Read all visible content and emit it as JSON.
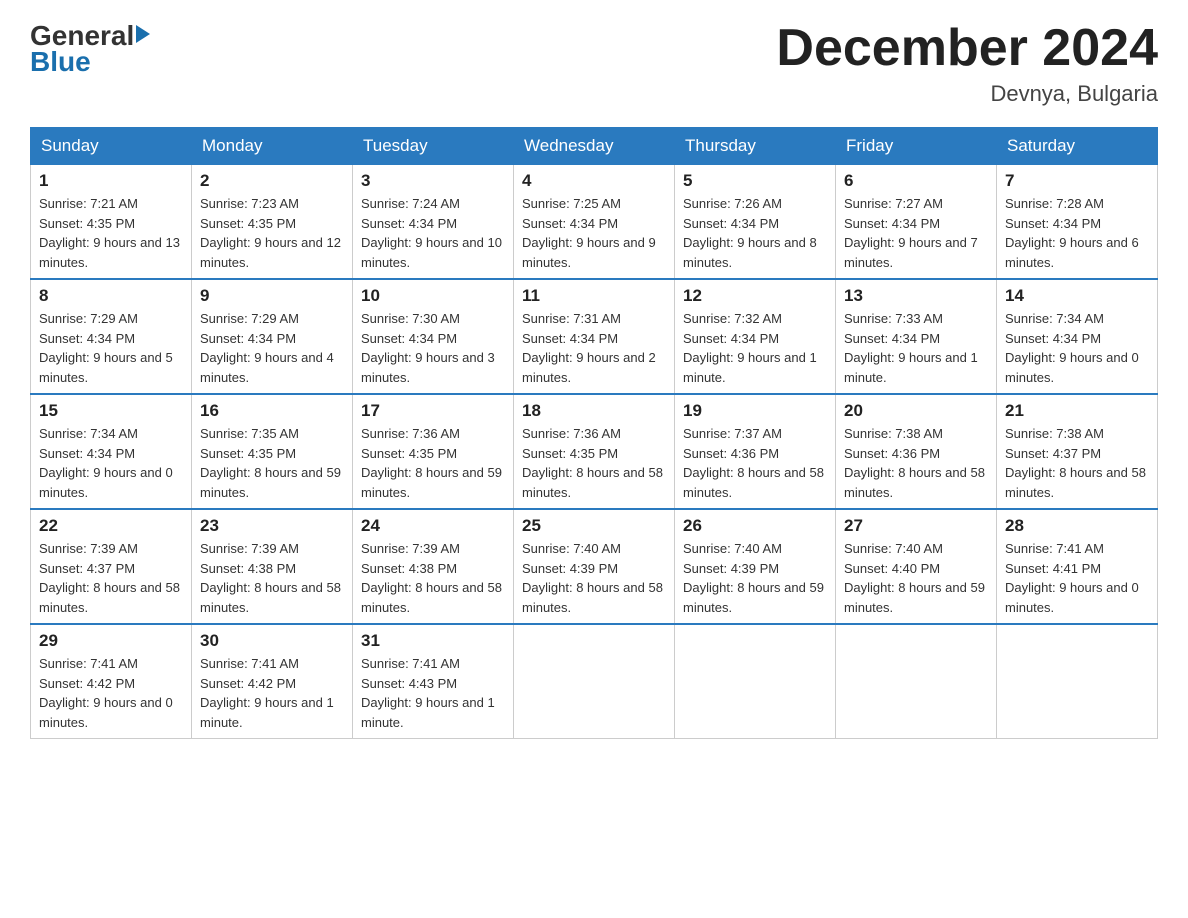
{
  "header": {
    "logo": {
      "general": "General",
      "blue": "Blue"
    },
    "title": "December 2024",
    "location": "Devnya, Bulgaria"
  },
  "calendar": {
    "days_of_week": [
      "Sunday",
      "Monday",
      "Tuesday",
      "Wednesday",
      "Thursday",
      "Friday",
      "Saturday"
    ],
    "weeks": [
      [
        {
          "day": "1",
          "sunrise": "7:21 AM",
          "sunset": "4:35 PM",
          "daylight": "9 hours and 13 minutes."
        },
        {
          "day": "2",
          "sunrise": "7:23 AM",
          "sunset": "4:35 PM",
          "daylight": "9 hours and 12 minutes."
        },
        {
          "day": "3",
          "sunrise": "7:24 AM",
          "sunset": "4:34 PM",
          "daylight": "9 hours and 10 minutes."
        },
        {
          "day": "4",
          "sunrise": "7:25 AM",
          "sunset": "4:34 PM",
          "daylight": "9 hours and 9 minutes."
        },
        {
          "day": "5",
          "sunrise": "7:26 AM",
          "sunset": "4:34 PM",
          "daylight": "9 hours and 8 minutes."
        },
        {
          "day": "6",
          "sunrise": "7:27 AM",
          "sunset": "4:34 PM",
          "daylight": "9 hours and 7 minutes."
        },
        {
          "day": "7",
          "sunrise": "7:28 AM",
          "sunset": "4:34 PM",
          "daylight": "9 hours and 6 minutes."
        }
      ],
      [
        {
          "day": "8",
          "sunrise": "7:29 AM",
          "sunset": "4:34 PM",
          "daylight": "9 hours and 5 minutes."
        },
        {
          "day": "9",
          "sunrise": "7:29 AM",
          "sunset": "4:34 PM",
          "daylight": "9 hours and 4 minutes."
        },
        {
          "day": "10",
          "sunrise": "7:30 AM",
          "sunset": "4:34 PM",
          "daylight": "9 hours and 3 minutes."
        },
        {
          "day": "11",
          "sunrise": "7:31 AM",
          "sunset": "4:34 PM",
          "daylight": "9 hours and 2 minutes."
        },
        {
          "day": "12",
          "sunrise": "7:32 AM",
          "sunset": "4:34 PM",
          "daylight": "9 hours and 1 minute."
        },
        {
          "day": "13",
          "sunrise": "7:33 AM",
          "sunset": "4:34 PM",
          "daylight": "9 hours and 1 minute."
        },
        {
          "day": "14",
          "sunrise": "7:34 AM",
          "sunset": "4:34 PM",
          "daylight": "9 hours and 0 minutes."
        }
      ],
      [
        {
          "day": "15",
          "sunrise": "7:34 AM",
          "sunset": "4:34 PM",
          "daylight": "9 hours and 0 minutes."
        },
        {
          "day": "16",
          "sunrise": "7:35 AM",
          "sunset": "4:35 PM",
          "daylight": "8 hours and 59 minutes."
        },
        {
          "day": "17",
          "sunrise": "7:36 AM",
          "sunset": "4:35 PM",
          "daylight": "8 hours and 59 minutes."
        },
        {
          "day": "18",
          "sunrise": "7:36 AM",
          "sunset": "4:35 PM",
          "daylight": "8 hours and 58 minutes."
        },
        {
          "day": "19",
          "sunrise": "7:37 AM",
          "sunset": "4:36 PM",
          "daylight": "8 hours and 58 minutes."
        },
        {
          "day": "20",
          "sunrise": "7:38 AM",
          "sunset": "4:36 PM",
          "daylight": "8 hours and 58 minutes."
        },
        {
          "day": "21",
          "sunrise": "7:38 AM",
          "sunset": "4:37 PM",
          "daylight": "8 hours and 58 minutes."
        }
      ],
      [
        {
          "day": "22",
          "sunrise": "7:39 AM",
          "sunset": "4:37 PM",
          "daylight": "8 hours and 58 minutes."
        },
        {
          "day": "23",
          "sunrise": "7:39 AM",
          "sunset": "4:38 PM",
          "daylight": "8 hours and 58 minutes."
        },
        {
          "day": "24",
          "sunrise": "7:39 AM",
          "sunset": "4:38 PM",
          "daylight": "8 hours and 58 minutes."
        },
        {
          "day": "25",
          "sunrise": "7:40 AM",
          "sunset": "4:39 PM",
          "daylight": "8 hours and 58 minutes."
        },
        {
          "day": "26",
          "sunrise": "7:40 AM",
          "sunset": "4:39 PM",
          "daylight": "8 hours and 59 minutes."
        },
        {
          "day": "27",
          "sunrise": "7:40 AM",
          "sunset": "4:40 PM",
          "daylight": "8 hours and 59 minutes."
        },
        {
          "day": "28",
          "sunrise": "7:41 AM",
          "sunset": "4:41 PM",
          "daylight": "9 hours and 0 minutes."
        }
      ],
      [
        {
          "day": "29",
          "sunrise": "7:41 AM",
          "sunset": "4:42 PM",
          "daylight": "9 hours and 0 minutes."
        },
        {
          "day": "30",
          "sunrise": "7:41 AM",
          "sunset": "4:42 PM",
          "daylight": "9 hours and 1 minute."
        },
        {
          "day": "31",
          "sunrise": "7:41 AM",
          "sunset": "4:43 PM",
          "daylight": "9 hours and 1 minute."
        },
        null,
        null,
        null,
        null
      ]
    ]
  }
}
